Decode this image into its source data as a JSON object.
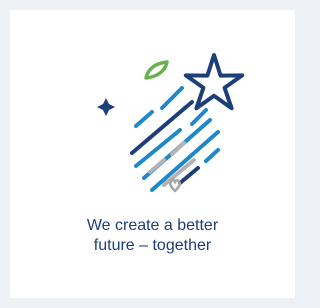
{
  "caption": {
    "line1": "We create a better",
    "line2": "future – together"
  },
  "icons": {
    "star": "star-icon",
    "sparkle": "sparkle-icon",
    "leaf": "leaf-icon",
    "heart": "heart-icon"
  },
  "colors": {
    "page_background": "#edf0f5",
    "card_background": "#ffffff",
    "caption_text": "#1c3f7a",
    "navy": "#1c3f7a",
    "blue": "#1e88c9",
    "gray": "#b3b3b3",
    "green": "#6ab04c"
  }
}
